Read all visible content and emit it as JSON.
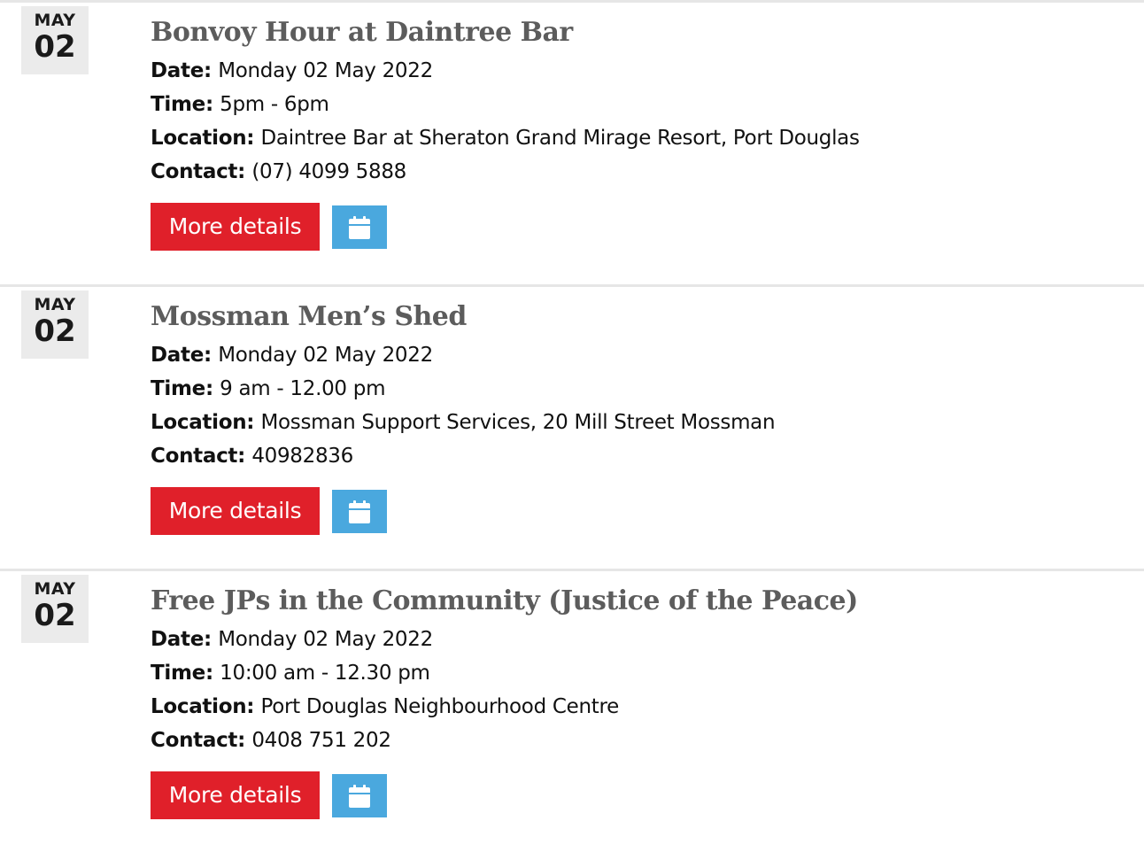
{
  "labels": {
    "date": "Date:",
    "time": "Time:",
    "location": "Location:",
    "contact": "Contact:",
    "more_details": "More details"
  },
  "colors": {
    "accent_red": "#e0202a",
    "calendar_blue": "#4aa8de",
    "title_gray": "#5c5c5c",
    "badge_bg": "#ebebeb"
  },
  "icons": {
    "calendar_button": "calendar-icon"
  },
  "events": [
    {
      "month": "MAY",
      "day": "02",
      "title": "Bonvoy Hour at Daintree Bar",
      "date": "Monday 02 May 2022",
      "time": "5pm - 6pm",
      "location": "Daintree Bar at Sheraton Grand Mirage Resort, Port Douglas",
      "contact": "(07) 4099 5888"
    },
    {
      "month": "MAY",
      "day": "02",
      "title": "Mossman Men’s Shed",
      "date": "Monday 02 May 2022",
      "time": "9 am - 12.00 pm",
      "location": "Mossman Support Services, 20 Mill Street Mossman",
      "contact": "40982836"
    },
    {
      "month": "MAY",
      "day": "02",
      "title": "Free JPs in the Community (Justice of the Peace)",
      "date": "Monday 02 May 2022",
      "time": "10:00 am - 12.30 pm",
      "location": "Port Douglas Neighbourhood Centre",
      "contact": "0408 751 202"
    }
  ]
}
